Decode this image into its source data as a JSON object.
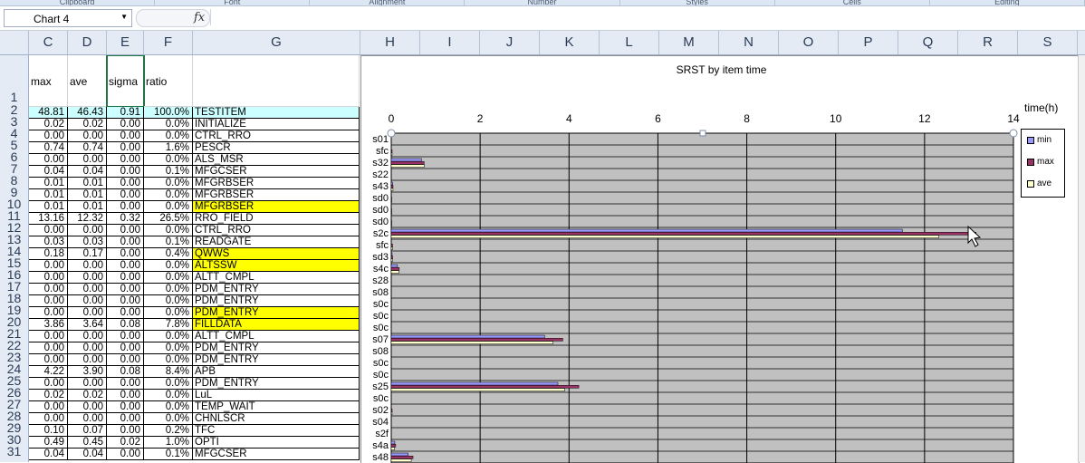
{
  "app": {
    "ribbon_groups": [
      "Clipboard",
      "Font",
      "Alignment",
      "Number",
      "Styles",
      "Cells",
      "Editing"
    ],
    "name_box": "Chart 4",
    "fx": "fx",
    "formula": ""
  },
  "columns": [
    "C",
    "D",
    "E",
    "F",
    "G",
    "H",
    "I",
    "J",
    "K",
    "L",
    "M",
    "N",
    "O",
    "P",
    "Q",
    "R",
    "S"
  ],
  "rows_numbers": [
    "1",
    "2",
    "3",
    "4",
    "5",
    "6",
    "7",
    "8",
    "9",
    "10",
    "11",
    "12",
    "13",
    "14",
    "15",
    "16",
    "17",
    "18",
    "19",
    "20",
    "21",
    "22",
    "23",
    "24",
    "25",
    "26",
    "27",
    "28",
    "29",
    "30",
    "31"
  ],
  "sheet": {
    "headers": [
      "max",
      "ave",
      "sigma",
      "ratio",
      ""
    ],
    "rows": [
      {
        "max": "48.81",
        "ave": "46.43",
        "sigma": "0.91",
        "ratio": "100.0%",
        "name": "TESTITEM",
        "hl": "cyan"
      },
      {
        "max": "0.02",
        "ave": "0.02",
        "sigma": "0.00",
        "ratio": "0.0%",
        "name": "INITIALIZE",
        "hl": ""
      },
      {
        "max": "0.00",
        "ave": "0.00",
        "sigma": "0.00",
        "ratio": "0.0%",
        "name": "CTRL_RRO",
        "hl": ""
      },
      {
        "max": "0.74",
        "ave": "0.74",
        "sigma": "0.00",
        "ratio": "1.6%",
        "name": "PESCR",
        "hl": ""
      },
      {
        "max": "0.00",
        "ave": "0.00",
        "sigma": "0.00",
        "ratio": "0.0%",
        "name": "ALS_MSR",
        "hl": ""
      },
      {
        "max": "0.04",
        "ave": "0.04",
        "sigma": "0.00",
        "ratio": "0.1%",
        "name": "MFGCSER",
        "hl": ""
      },
      {
        "max": "0.01",
        "ave": "0.01",
        "sigma": "0.00",
        "ratio": "0.0%",
        "name": "MFGRBSER",
        "hl": ""
      },
      {
        "max": "0.01",
        "ave": "0.01",
        "sigma": "0.00",
        "ratio": "0.0%",
        "name": "MFGRBSER",
        "hl": ""
      },
      {
        "max": "0.01",
        "ave": "0.01",
        "sigma": "0.00",
        "ratio": "0.0%",
        "name": "MFGRBSER",
        "hl": "yellow"
      },
      {
        "max": "13.16",
        "ave": "12.32",
        "sigma": "0.32",
        "ratio": "26.5%",
        "name": "RRO_FIELD",
        "hl": ""
      },
      {
        "max": "0.00",
        "ave": "0.00",
        "sigma": "0.00",
        "ratio": "0.0%",
        "name": "CTRL_RRO",
        "hl": ""
      },
      {
        "max": "0.03",
        "ave": "0.03",
        "sigma": "0.00",
        "ratio": "0.1%",
        "name": "READGATE",
        "hl": ""
      },
      {
        "max": "0.18",
        "ave": "0.17",
        "sigma": "0.00",
        "ratio": "0.4%",
        "name": "QWWS",
        "hl": "yellow"
      },
      {
        "max": "0.00",
        "ave": "0.00",
        "sigma": "0.00",
        "ratio": "0.0%",
        "name": "ALTSSW",
        "hl": "yellow"
      },
      {
        "max": "0.00",
        "ave": "0.00",
        "sigma": "0.00",
        "ratio": "0.0%",
        "name": "ALTT_CMPL",
        "hl": ""
      },
      {
        "max": "0.00",
        "ave": "0.00",
        "sigma": "0.00",
        "ratio": "0.0%",
        "name": "PDM_ENTRY",
        "hl": ""
      },
      {
        "max": "0.00",
        "ave": "0.00",
        "sigma": "0.00",
        "ratio": "0.0%",
        "name": "PDM_ENTRY",
        "hl": ""
      },
      {
        "max": "0.00",
        "ave": "0.00",
        "sigma": "0.00",
        "ratio": "0.0%",
        "name": "PDM_ENTRY",
        "hl": "yellow"
      },
      {
        "max": "3.86",
        "ave": "3.64",
        "sigma": "0.08",
        "ratio": "7.8%",
        "name": "FILLDATA",
        "hl": "yellow"
      },
      {
        "max": "0.00",
        "ave": "0.00",
        "sigma": "0.00",
        "ratio": "0.0%",
        "name": "ALTT_CMPL",
        "hl": ""
      },
      {
        "max": "0.00",
        "ave": "0.00",
        "sigma": "0.00",
        "ratio": "0.0%",
        "name": "PDM_ENTRY",
        "hl": ""
      },
      {
        "max": "0.00",
        "ave": "0.00",
        "sigma": "0.00",
        "ratio": "0.0%",
        "name": "PDM_ENTRY",
        "hl": ""
      },
      {
        "max": "4.22",
        "ave": "3.90",
        "sigma": "0.08",
        "ratio": "8.4%",
        "name": "APB",
        "hl": ""
      },
      {
        "max": "0.00",
        "ave": "0.00",
        "sigma": "0.00",
        "ratio": "0.0%",
        "name": "PDM_ENTRY",
        "hl": ""
      },
      {
        "max": "0.02",
        "ave": "0.02",
        "sigma": "0.00",
        "ratio": "0.0%",
        "name": "LuL",
        "hl": ""
      },
      {
        "max": "0.00",
        "ave": "0.00",
        "sigma": "0.00",
        "ratio": "0.0%",
        "name": "TEMP_WAIT",
        "hl": ""
      },
      {
        "max": "0.00",
        "ave": "0.00",
        "sigma": "0.00",
        "ratio": "0.0%",
        "name": "CHNLSCR",
        "hl": ""
      },
      {
        "max": "0.10",
        "ave": "0.07",
        "sigma": "0.00",
        "ratio": "0.2%",
        "name": "TFC",
        "hl": ""
      },
      {
        "max": "0.49",
        "ave": "0.45",
        "sigma": "0.02",
        "ratio": "1.0%",
        "name": "OPTI",
        "hl": ""
      },
      {
        "max": "0.04",
        "ave": "0.04",
        "sigma": "0.00",
        "ratio": "0.1%",
        "name": "MFGCSER",
        "hl": ""
      }
    ]
  },
  "chart_data": {
    "type": "bar",
    "title": "SRST by item time",
    "xlabel": "time(h)",
    "xlim": [
      0,
      14
    ],
    "x_ticks": [
      "0",
      "2",
      "4",
      "6",
      "8",
      "10",
      "12",
      "14"
    ],
    "orientation": "horizontal",
    "categories": [
      "s01",
      "sfc",
      "s32",
      "s22",
      "s43",
      "sd0",
      "sd0",
      "sd0",
      "s2c",
      "sfc",
      "sd3",
      "s4c",
      "s28",
      "s08",
      "s0c",
      "s0c",
      "s0c",
      "s07",
      "s08",
      "s0c",
      "s0c",
      "s25",
      "s0c",
      "s02",
      "s04",
      "s2f",
      "s4a",
      "s48"
    ],
    "series": [
      {
        "name": "min",
        "color": "#9999ff",
        "values": [
          0,
          0,
          0.68,
          0,
          0.03,
          0,
          0,
          0,
          11.5,
          0,
          0.02,
          0.14,
          0,
          0,
          0,
          0,
          0,
          3.45,
          0,
          0,
          0,
          3.75,
          0,
          0,
          0,
          0,
          0.08,
          0.38
        ]
      },
      {
        "name": "max",
        "color": "#993366",
        "values": [
          0,
          0.02,
          0.74,
          0,
          0.04,
          0.01,
          0.01,
          0.01,
          13.16,
          0.03,
          0.03,
          0.18,
          0,
          0,
          0,
          0,
          0,
          3.86,
          0,
          0,
          0,
          4.22,
          0,
          0.02,
          0,
          0,
          0.1,
          0.49
        ]
      },
      {
        "name": "ave",
        "color": "#ffffcc",
        "values": [
          0,
          0.02,
          0.74,
          0,
          0.04,
          0.01,
          0.01,
          0.01,
          12.32,
          0.03,
          0.03,
          0.17,
          0,
          0,
          0,
          0,
          0,
          3.64,
          0,
          0,
          0,
          3.9,
          0,
          0.02,
          0,
          0,
          0.07,
          0.45
        ]
      }
    ],
    "legend": "right",
    "grid": true,
    "plot_background": "#c0c0c0"
  }
}
